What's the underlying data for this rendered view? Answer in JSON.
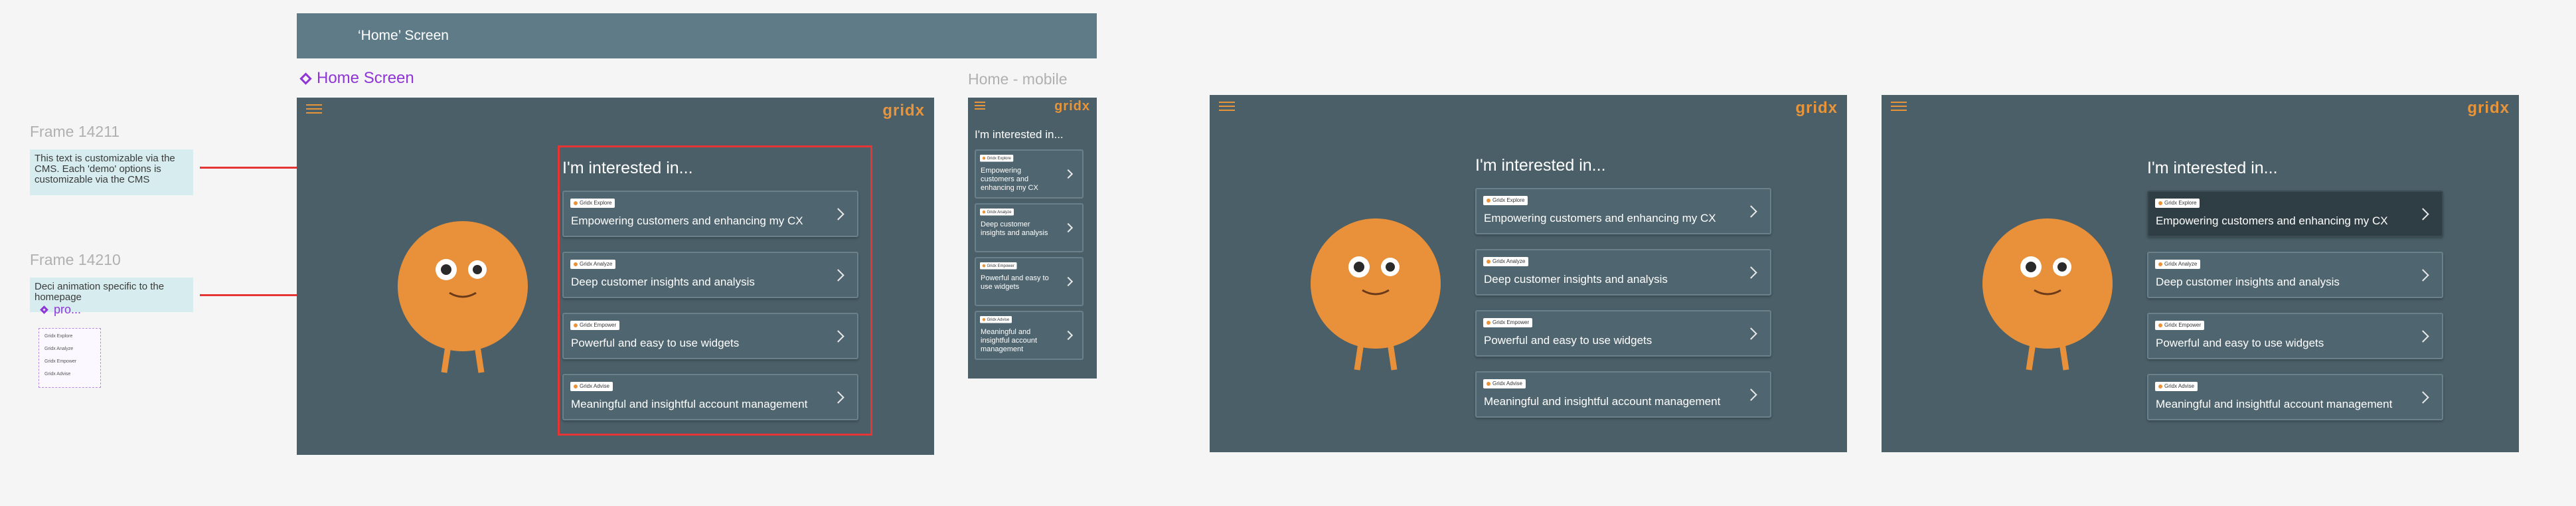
{
  "frame": {
    "title": "‘Home’ Screen"
  },
  "component": {
    "label": "Home Screen"
  },
  "mobile": {
    "label": "Home - mobile",
    "heading": "I'm interested in..."
  },
  "annotations": {
    "frame1": {
      "label": "Frame 14211",
      "note": "This text is customizable via the CMS. Each 'demo' options is customizable via the CMS"
    },
    "frame2": {
      "label": "Frame 14210",
      "note": "Deci animation specific to the homepage"
    },
    "props_label": "pro...",
    "props_items": [
      "Gridx Explore",
      "Gridx Analyze",
      "Gridx Empower",
      "Gridx Advise"
    ]
  },
  "screen": {
    "logo": "gridx",
    "heading": "I'm interested in...",
    "cards": [
      {
        "tag": "Gridx Explore",
        "text": "Empowering customers and enhancing my CX"
      },
      {
        "tag": "Gridx Analyze",
        "text": "Deep customer insights and analysis"
      },
      {
        "tag": "Gridx Empower",
        "text": "Powerful and easy to use widgets"
      },
      {
        "tag": "Gridx Advise",
        "text": "Meaningful and insightful account management"
      }
    ]
  },
  "mobile_cards": [
    {
      "tag": "Gridx Explore",
      "text": "Empowering customers and enhancing my CX"
    },
    {
      "tag": "Gridx Analyze",
      "text": "Deep customer insights and analysis"
    },
    {
      "tag": "Gridx Empower",
      "text": "Powerful and easy to use widgets"
    },
    {
      "tag": "Gridx Advise",
      "text": "Meaningful and insightful account management"
    }
  ],
  "colors": {
    "accent": "#e8943a",
    "screen_bg": "#4a5f68",
    "highlight": "#e53535",
    "component": "#8f35d8"
  }
}
